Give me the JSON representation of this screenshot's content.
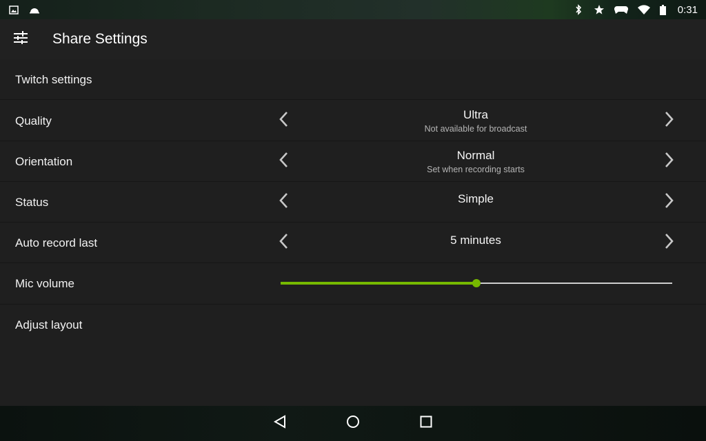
{
  "status_bar": {
    "time": "0:31",
    "left_icons": [
      "image-icon",
      "dome-icon"
    ],
    "right_icons": [
      "bluetooth-icon",
      "star-icon",
      "gamepad-icon",
      "wifi-icon",
      "battery-icon"
    ]
  },
  "app_bar": {
    "title": "Share Settings",
    "menu_icon": "sliders-icon"
  },
  "settings": {
    "twitch": {
      "label": "Twitch settings"
    },
    "quality": {
      "label": "Quality",
      "value": "Ultra",
      "subtitle": "Not available for broadcast"
    },
    "orientation": {
      "label": "Orientation",
      "value": "Normal",
      "subtitle": "Set when recording starts"
    },
    "status": {
      "label": "Status",
      "value": "Simple"
    },
    "auto_record": {
      "label": "Auto record last",
      "value": "5 minutes"
    },
    "mic_volume": {
      "label": "Mic volume",
      "level": 0.5
    },
    "adjust_layout": {
      "label": "Adjust layout"
    }
  },
  "nav_bar": {
    "buttons": [
      "back-icon",
      "home-icon",
      "recents-icon"
    ]
  },
  "colors": {
    "accent": "#76b900",
    "surface": "#1f1f1f",
    "app_bar": "#212121"
  }
}
